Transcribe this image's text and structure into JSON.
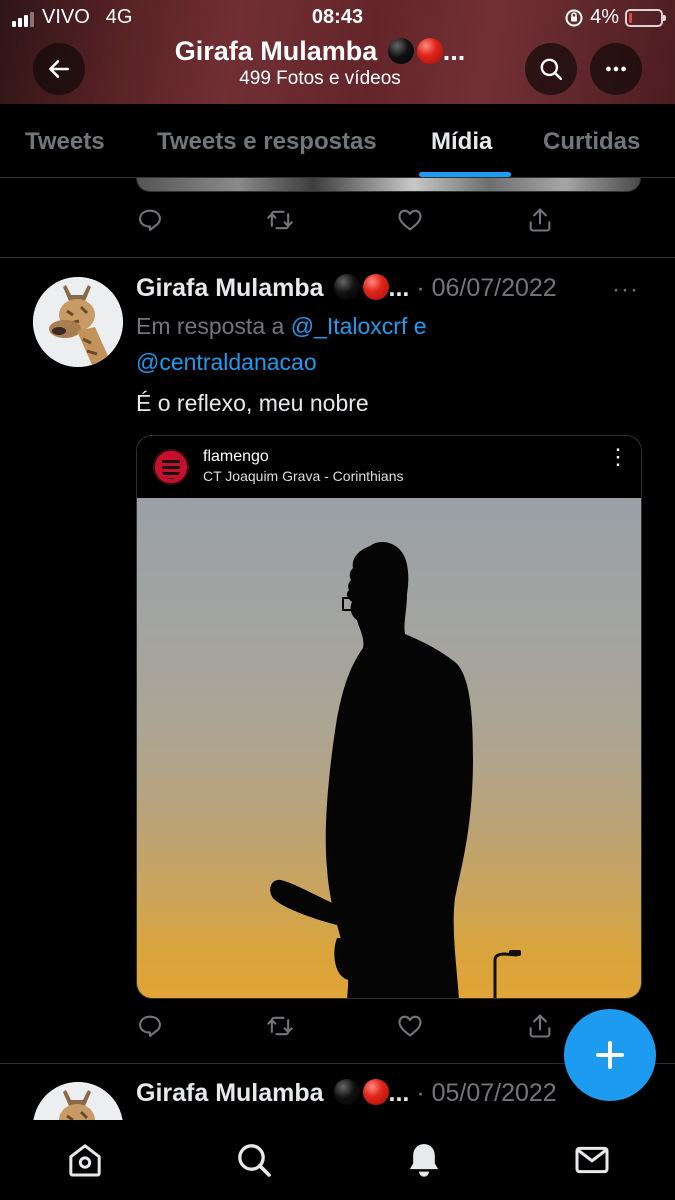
{
  "status_bar": {
    "carrier": "VIVO",
    "network": "4G",
    "time": "08:43",
    "battery": "4%"
  },
  "header": {
    "title": "Girafa Mulamba",
    "title_suffix": "...",
    "subtitle": "499 Fotos e vídeos",
    "back_icon": "arrow-left-icon",
    "search_icon": "search-icon",
    "more_icon": "more-horizontal-icon"
  },
  "tabs": [
    {
      "label": "Tweets",
      "active": false
    },
    {
      "label": "Tweets e respostas",
      "active": false
    },
    {
      "label": "Mídia",
      "active": true
    },
    {
      "label": "Curtidas",
      "active": false
    }
  ],
  "tweet": {
    "author": "Girafa Mulamba",
    "emoji_suffix": "...",
    "separator": "·",
    "date": "06/07/2022",
    "more": "···",
    "reply_prefix": "Em resposta a",
    "mention_1": "@_Italoxcrf",
    "reply_joiner": "e",
    "mention_2": "@centraldanacao",
    "text": "É o reflexo, meu nobre",
    "media": {
      "ig_username": "flamengo",
      "ig_location": "CT Joaquim Grava - Corinthians",
      "ig_menu": "⋮"
    }
  },
  "next_tweet": {
    "author": "Girafa Mulamba",
    "emoji_suffix": "...",
    "separator": "·",
    "date": "05/07/2022"
  },
  "actions": [
    "reply-icon",
    "retweet-icon",
    "like-icon",
    "share-icon"
  ],
  "bottom_nav": [
    "home-icon",
    "search-icon",
    "notifications-icon",
    "messages-icon"
  ],
  "colors": {
    "accent": "#1d9bf0",
    "background": "#000000",
    "muted": "#71767b",
    "text": "#e7e9ea",
    "divider": "#2f3336"
  }
}
